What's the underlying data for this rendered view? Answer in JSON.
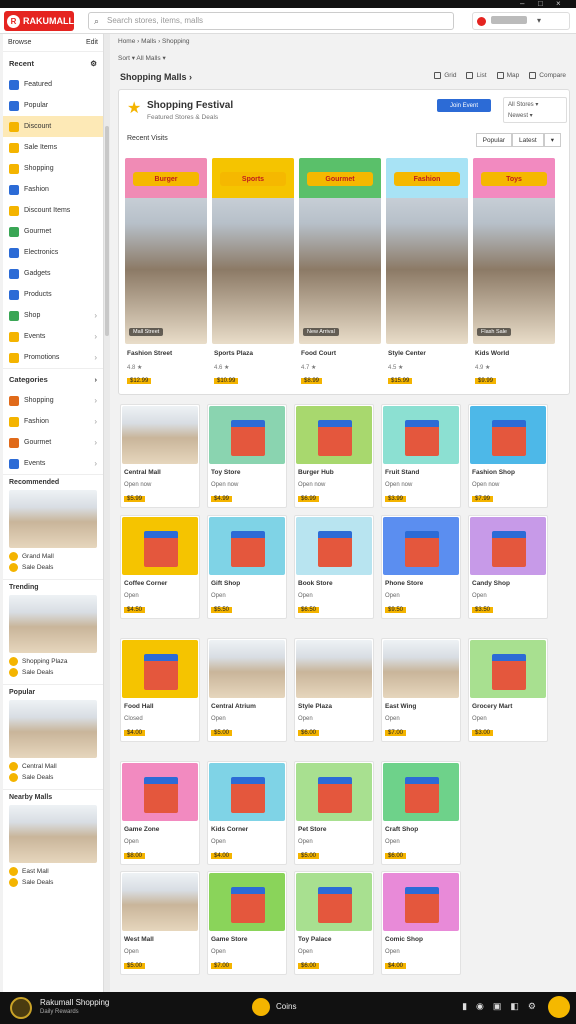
{
  "window": {
    "controls": [
      "–",
      "□",
      "×"
    ]
  },
  "header": {
    "logo": "RAKUMALL",
    "logo_mark": "R",
    "search_placeholder": "Search stores, items, malls"
  },
  "sidebar": {
    "heading": "Browse",
    "heading_action": "Edit",
    "section1": "Recent",
    "items": [
      {
        "label": "Featured",
        "icon": "store-icon",
        "color": "#2c6bd6"
      },
      {
        "label": "Popular",
        "icon": "star-icon",
        "color": "#2c6bd6"
      },
      {
        "label": "Discount",
        "icon": "tag-icon",
        "color": "#f4b400"
      },
      {
        "label": "Sale Items",
        "icon": "percent-icon",
        "color": "#f4b400"
      },
      {
        "label": "Shopping",
        "icon": "bag-icon",
        "color": "#f4b400"
      },
      {
        "label": "Fashion",
        "icon": "shirt-icon",
        "color": "#2c6bd6"
      },
      {
        "label": "Discount Items",
        "icon": "coin-icon",
        "color": "#f4b400"
      },
      {
        "label": "Gourmet",
        "icon": "food-icon",
        "color": "#3aa655"
      },
      {
        "label": "Electronics",
        "icon": "device-icon",
        "color": "#2c6bd6"
      },
      {
        "label": "Gadgets",
        "icon": "gadget-icon",
        "color": "#2c6bd6"
      },
      {
        "label": "Products",
        "icon": "box-icon",
        "color": "#2c6bd6"
      },
      {
        "label": "Shop",
        "icon": "cart-icon",
        "color": "#3aa655"
      },
      {
        "label": "Events",
        "icon": "calendar-icon",
        "color": "#f4b400"
      },
      {
        "label": "Promotions",
        "icon": "megaphone-icon",
        "color": "#f4b400"
      }
    ],
    "section2": "Categories",
    "items2": [
      {
        "label": "Shopping",
        "icon": "bag-icon",
        "color": "#e06a1a"
      },
      {
        "label": "Fashion",
        "icon": "shirt-icon",
        "color": "#f4b400"
      },
      {
        "label": "Gourmet",
        "icon": "food-icon",
        "color": "#e06a1a"
      },
      {
        "label": "Events",
        "icon": "calendar-icon",
        "color": "#2c6bd6"
      }
    ],
    "cards": [
      {
        "title": "Recommended",
        "line1": "Grand Mall",
        "line2": "Sale Deals"
      },
      {
        "title": "Trending",
        "line1": "Shopping Plaza",
        "line2": "Sale Deals"
      },
      {
        "title": "Popular",
        "line1": "Central Mall",
        "line2": "Sale Deals"
      },
      {
        "title": "Nearby Malls",
        "line1": "East Mall",
        "line2": "Sale Deals"
      }
    ]
  },
  "main": {
    "breadcrumb": "Home › Malls › Shopping",
    "filter": "Sort ▾   All Malls ▾",
    "title": "Shopping Malls ›",
    "view_buttons": [
      "Grid",
      "List",
      "Map",
      "Compare"
    ],
    "feature": {
      "title": "Shopping Festival",
      "subtitle": "Featured Stores & Deals",
      "promo_button": "Join Event",
      "select_line1": "All Stores ▾",
      "select_line2": "Newest ▾",
      "section_label": "Recent Visits",
      "sort_options": [
        "Popular",
        "Latest",
        "▾"
      ],
      "cards": [
        {
          "banner": "Burger",
          "name": "Fashion Street",
          "meta": "4.8 ★",
          "price": "$12.99",
          "tag": "Mall Street",
          "banner_color": "#f08bb5"
        },
        {
          "banner": "Sports",
          "name": "Sports Plaza",
          "meta": "4.6 ★",
          "price": "$10.99",
          "tag": "",
          "banner_color": "#f5c400"
        },
        {
          "banner": "Gourmet",
          "name": "Food Court",
          "meta": "4.7 ★",
          "price": "$8.99",
          "tag": "New Arrival",
          "banner_color": "#5ac06a"
        },
        {
          "banner": "Fashion",
          "name": "Style Center",
          "meta": "4.5 ★",
          "price": "$15.99",
          "tag": "",
          "banner_color": "#a8e3f5"
        },
        {
          "banner": "Toys",
          "name": "Kids World",
          "meta": "4.9 ★",
          "price": "$9.99",
          "tag": "Flash Sale",
          "banner_color": "#f28ac0"
        }
      ]
    },
    "grid": [
      {
        "name": "Central Mall",
        "meta": "Open now",
        "price": "$5.99",
        "style": "mall"
      },
      {
        "name": "Toy Store",
        "meta": "Open now",
        "price": "$4.99",
        "style": "shop",
        "bg": "#8ad4b0"
      },
      {
        "name": "Burger Hub",
        "meta": "Open now",
        "price": "$6.99",
        "style": "shop",
        "bg": "#a8d86e"
      },
      {
        "name": "Fruit Stand",
        "meta": "Open now",
        "price": "$3.99",
        "style": "shop",
        "bg": "#8ce0d2"
      },
      {
        "name": "Fashion Shop",
        "meta": "Open now",
        "price": "$7.99",
        "style": "shop",
        "bg": "#4db8e8"
      },
      {
        "name": "Coffee Corner",
        "meta": "Open",
        "price": "$4.50",
        "style": "shop",
        "bg": "#f5c400"
      },
      {
        "name": "Gift Shop",
        "meta": "Open",
        "price": "$5.50",
        "style": "shop",
        "bg": "#7fd3e6"
      },
      {
        "name": "Book Store",
        "meta": "Open",
        "price": "$6.50",
        "style": "shop",
        "bg": "#b8e4f0"
      },
      {
        "name": "Phone Store",
        "meta": "Open",
        "price": "$9.50",
        "style": "shop",
        "bg": "#5b8ef0"
      },
      {
        "name": "Candy Shop",
        "meta": "Open",
        "price": "$3.50",
        "style": "shop",
        "bg": "#c79ae8"
      },
      {
        "name": "Food Hall",
        "meta": "Closed",
        "price": "$4.00",
        "style": "shop",
        "bg": "#f5c400"
      },
      {
        "name": "Central Atrium",
        "meta": "Open",
        "price": "$5.00",
        "style": "mall"
      },
      {
        "name": "Style Plaza",
        "meta": "Open",
        "price": "$6.00",
        "style": "mall"
      },
      {
        "name": "East Wing",
        "meta": "Open",
        "price": "$7.00",
        "style": "mall"
      },
      {
        "name": "Grocery Mart",
        "meta": "Open",
        "price": "$3.00",
        "style": "shop",
        "bg": "#a8e090"
      },
      {
        "name": "Game Zone",
        "meta": "Open",
        "price": "$8.00",
        "style": "shop",
        "bg": "#f28ac0"
      },
      {
        "name": "Kids Corner",
        "meta": "Open",
        "price": "$4.00",
        "style": "shop",
        "bg": "#7fd3e6"
      },
      {
        "name": "Pet Store",
        "meta": "Open",
        "price": "$5.00",
        "style": "shop",
        "bg": "#a8e090"
      },
      {
        "name": "Craft Shop",
        "meta": "Open",
        "price": "$6.00",
        "style": "shop",
        "bg": "#6ed28a"
      },
      {
        "name": "West Mall",
        "meta": "Open",
        "price": "$5.00",
        "style": "mall"
      },
      {
        "name": "Game Store",
        "meta": "Open",
        "price": "$7.00",
        "style": "shop",
        "bg": "#8ad45a"
      },
      {
        "name": "Toy Palace",
        "meta": "Open",
        "price": "$6.00",
        "style": "shop",
        "bg": "#a8e090"
      },
      {
        "name": "Comic Shop",
        "meta": "Open",
        "price": "$4.00",
        "style": "shop",
        "bg": "#e88ad8"
      }
    ]
  },
  "footer": {
    "title": "Rakumall Shopping",
    "subtitle": "Daily Rewards",
    "coins": "Coins"
  }
}
